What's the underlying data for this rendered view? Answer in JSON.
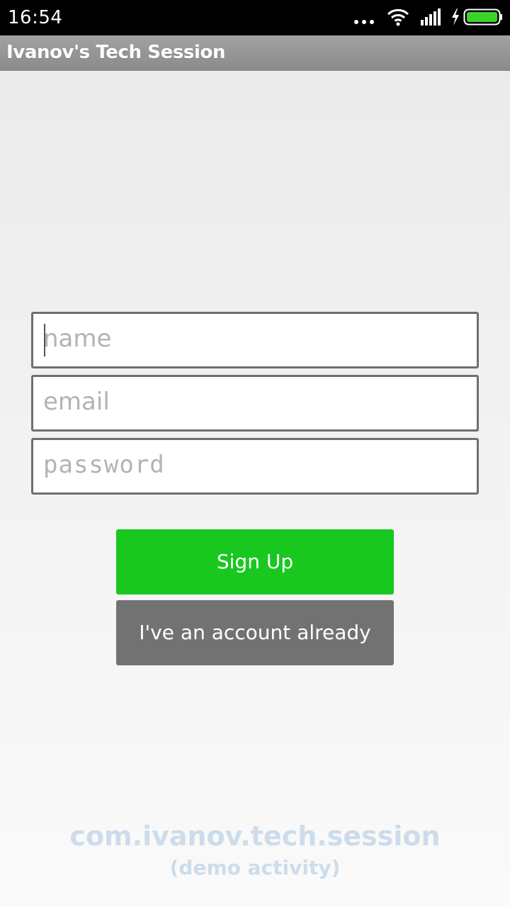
{
  "status_bar": {
    "time": "16:54",
    "icons": [
      "more-dots-icon",
      "wifi-icon",
      "cell-signal-icon",
      "charging-bolt-icon",
      "battery-icon"
    ]
  },
  "action_bar": {
    "title": "Ivanov's Tech Session"
  },
  "form": {
    "name_placeholder": "name",
    "email_placeholder": "email",
    "password_placeholder": "password",
    "name_value": "",
    "email_value": "",
    "password_value": ""
  },
  "buttons": {
    "signup_label": "Sign Up",
    "login_label": "I've an account already"
  },
  "footer": {
    "package": "com.ivanov.tech.session",
    "note": "(demo activity)"
  },
  "colors": {
    "signup_button": "#18c81e",
    "login_button": "#727272",
    "footer_text": "#cddceb",
    "battery_fill": "#3cd42b"
  }
}
